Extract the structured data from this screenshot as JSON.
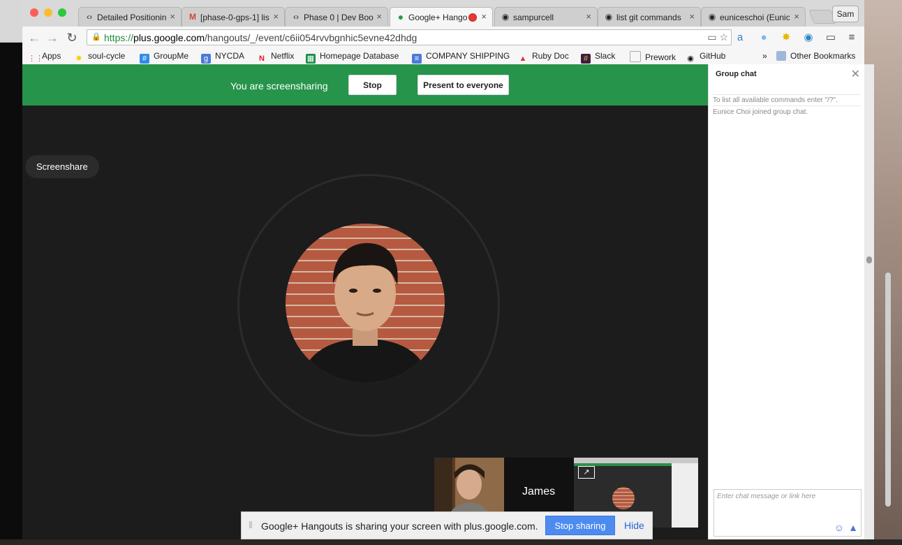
{
  "browser": {
    "tabs": [
      {
        "label": "Detailed Positionin",
        "icon": "code-icon"
      },
      {
        "label": "[phase-0-gps-1] lis",
        "icon": "gmail-icon"
      },
      {
        "label": "Phase 0 | Dev Boo",
        "icon": "code-icon"
      },
      {
        "label": "Google+ Hango",
        "icon": "hangouts-icon"
      },
      {
        "label": "sampurcell",
        "icon": "github-icon"
      },
      {
        "label": "list git commands",
        "icon": "github-icon"
      },
      {
        "label": "euniceschoi (Eunic",
        "icon": "github-icon"
      }
    ],
    "profile": "Sam",
    "url": {
      "scheme": "https://",
      "host": "plus.google.com",
      "path": "/hangouts/_/event/c6ii054rvvbgnhic5evne42dhdg"
    },
    "bookmarks": [
      {
        "label": "Apps",
        "icon": "apps-grid-icon"
      },
      {
        "label": "soul-cycle",
        "icon": "sun-icon"
      },
      {
        "label": "GroupMe",
        "icon": "groupme-icon"
      },
      {
        "label": "NYCDA",
        "icon": "g-icon"
      },
      {
        "label": "Netflix",
        "icon": "netflix-icon"
      },
      {
        "label": "Homepage Database",
        "icon": "sheets-icon"
      },
      {
        "label": "COMPANY SHIPPING",
        "icon": "docs-icon"
      },
      {
        "label": "Ruby Doc",
        "icon": "thumb-icon"
      },
      {
        "label": "Slack",
        "icon": "slack-icon"
      },
      {
        "label": "Prework",
        "icon": "page-icon"
      },
      {
        "label": "GitHub",
        "icon": "github-icon"
      }
    ],
    "overflow": "»",
    "other_bookmarks": "Other Bookmarks"
  },
  "hangout": {
    "sharing_status": "You are screensharing",
    "stop_label": "Stop",
    "present_label": "Present to everyone",
    "screenshare_label": "Screenshare",
    "participant_name": "James",
    "notice": {
      "text": "Google+ Hangouts is sharing your screen with plus.google.com.",
      "stop_sharing": "Stop sharing",
      "hide": "Hide"
    }
  },
  "chat": {
    "title": "Group chat",
    "messages": [
      "To list all available commands enter \"/?\".",
      "Eunice Choi joined group chat."
    ],
    "input_placeholder": "Enter chat message or link here"
  },
  "colors": {
    "green_bar": "#27944b",
    "stage": "#1c1c1c",
    "accent_blue": "#4d8bf0"
  }
}
